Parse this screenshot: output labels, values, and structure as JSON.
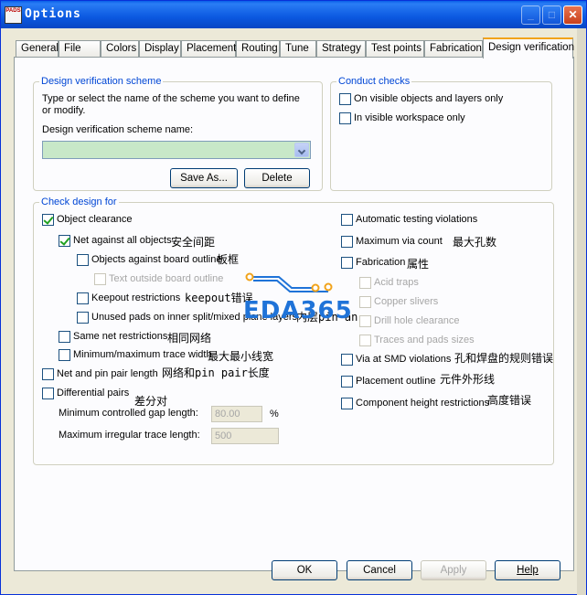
{
  "window": {
    "title": "Options",
    "icon_text": "PADS"
  },
  "tabs": [
    {
      "label": "General"
    },
    {
      "label": "File"
    },
    {
      "label": "Colors"
    },
    {
      "label": "Display"
    },
    {
      "label": "Placement"
    },
    {
      "label": "Routing"
    },
    {
      "label": "Tune"
    },
    {
      "label": "Strategy"
    },
    {
      "label": "Test points"
    },
    {
      "label": "Fabrication"
    },
    {
      "label": "Design verification"
    }
  ],
  "scheme": {
    "group_label": "Design verification scheme",
    "description": "Type or select the name of the scheme you want to define or modify.",
    "name_label": "Design verification scheme name:",
    "name_value": "",
    "save_as": "Save As...",
    "delete": "Delete"
  },
  "conduct": {
    "group_label": "Conduct checks",
    "on_visible": "On visible objects and layers only",
    "in_visible_workspace": "In visible workspace only"
  },
  "check": {
    "group_label": "Check design for",
    "object_clearance": "Object clearance",
    "net_against_all": "Net against all objects",
    "net_against_all_cn": "安全间距",
    "objects_against_board": "Objects against board outline",
    "objects_against_board_cn": "板框",
    "text_outside_board": "Text outside board outline",
    "keepout": "Keepout restrictions",
    "keepout_cn": "keepout错误",
    "unused_pads": "Unused pads on inner split/mixed plane layers",
    "unused_pads_cn": "内层pin an",
    "same_net": "Same net restrictions",
    "same_net_cn": "相同网络",
    "min_max_trace": "Minimum/maximum trace width",
    "min_max_trace_cn": "最大最小线宽",
    "net_pin_pair": "Net and pin pair length",
    "net_pin_pair_cn": "网络和pin pair长度",
    "differential": "Differential pairs",
    "differential_cn": "差分对",
    "min_gap_label": "Minimum controlled gap length:",
    "min_gap_value": "80.00",
    "min_gap_unit": "%",
    "max_irregular_label": "Maximum irregular trace length:",
    "max_irregular_value": "500",
    "auto_testing": "Automatic testing violations",
    "max_via": "Maximum via count",
    "max_via_cn": "最大孔数",
    "fabrication": "Fabrication",
    "fabrication_cn": "属性",
    "acid_traps": "Acid traps",
    "copper_slivers": "Copper slivers",
    "drill_hole": "Drill hole clearance",
    "traces_pads": "Traces and pads sizes",
    "via_smd": "Via at SMD violations",
    "via_smd_cn": "孔和焊盘的规则错误",
    "placement_outline": "Placement outline",
    "placement_outline_cn": "元件外形线",
    "component_height": "Component height restrictions",
    "component_height_cn": "高度错误"
  },
  "watermark": "EDA365",
  "buttons": {
    "ok": "OK",
    "cancel": "Cancel",
    "apply": "Apply",
    "help": "Help"
  },
  "colors": {
    "titlebar": "#0a5fe8",
    "group_label": "#0046d5",
    "combo_bg": "#c8e8c8",
    "watermark": "#1f73d8",
    "checkmark": "#21a121"
  }
}
